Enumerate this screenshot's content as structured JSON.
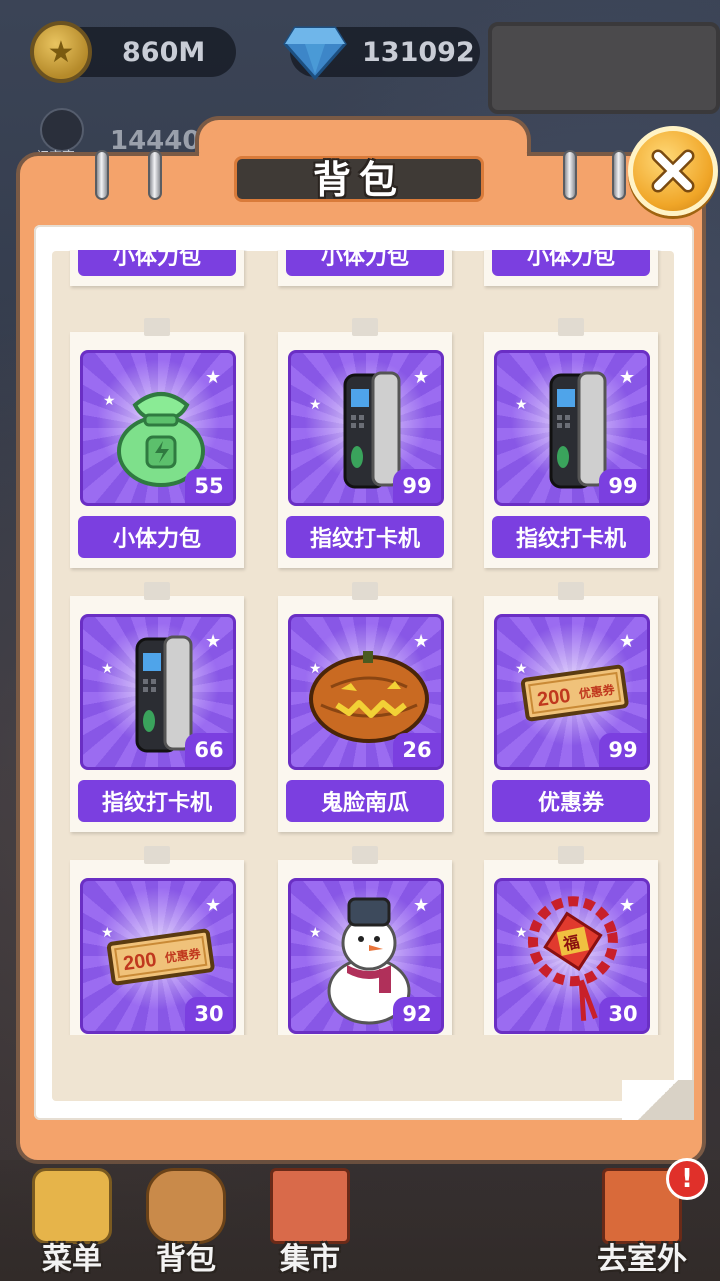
{
  "resources": {
    "coins": "860M",
    "gems": "131092",
    "rank_value": "14440",
    "rank_label": "初实官"
  },
  "panel": {
    "title": "背包",
    "close_icon": "close-icon"
  },
  "items": [
    {
      "name": "小体力包",
      "count": "55",
      "icon": "stamina-bag-icon"
    },
    {
      "name": "指纹打卡机",
      "count": "99",
      "icon": "fingerprint-machine-icon"
    },
    {
      "name": "指纹打卡机",
      "count": "99",
      "icon": "fingerprint-machine-icon"
    },
    {
      "name": "指纹打卡机",
      "count": "66",
      "icon": "fingerprint-machine-icon"
    },
    {
      "name": "鬼脸南瓜",
      "count": "26",
      "icon": "pumpkin-icon"
    },
    {
      "name": "优惠券",
      "count": "99",
      "icon": "coupon-icon",
      "coupon_text": "200",
      "coupon_sub": "优惠券"
    },
    {
      "name": "",
      "count": "30",
      "icon": "coupon-icon",
      "coupon_text": "200",
      "coupon_sub": "优惠券"
    },
    {
      "name": "",
      "count": "92",
      "icon": "snowman-icon"
    },
    {
      "name": "",
      "count": "30",
      "icon": "chinese-knot-icon",
      "knot_text": "福"
    }
  ],
  "partial_row_names": [
    "小体力包",
    "小体力包",
    "小体力包"
  ],
  "nav": [
    {
      "label": "菜单",
      "icon": "menu-icon"
    },
    {
      "label": "背包",
      "icon": "backpack-icon"
    },
    {
      "label": "集市",
      "icon": "market-icon"
    },
    {
      "label": "去室外",
      "icon": "outdoor-icon"
    }
  ],
  "nav_alert": "!",
  "colors": {
    "panel_orange": "#f4a36b",
    "item_purple": "#7b3fe0",
    "close_gold": "#f0a628"
  }
}
